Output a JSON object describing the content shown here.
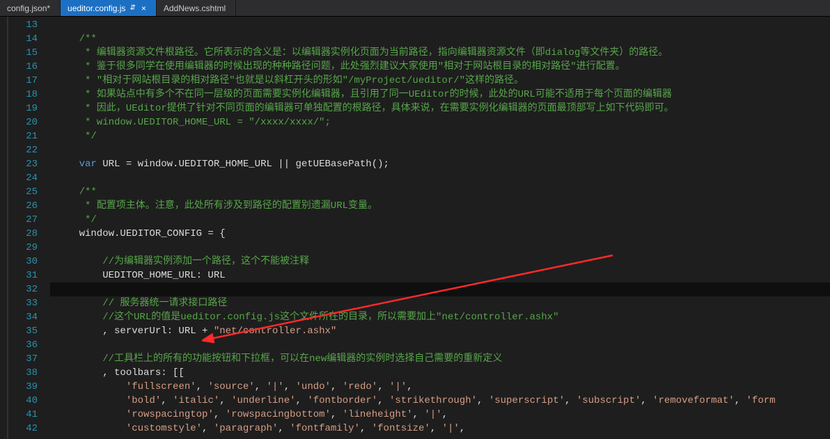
{
  "tabs": [
    {
      "label": "config.json*",
      "active": false
    },
    {
      "label": "ueditor.config.js",
      "active": true,
      "pinned": true,
      "closable": true
    },
    {
      "label": "AddNews.cshtml",
      "active": false
    }
  ],
  "startLine": 13,
  "lines": [
    {
      "n": 13,
      "segs": []
    },
    {
      "n": 14,
      "segs": [
        {
          "t": "    ",
          "c": "plain"
        },
        {
          "t": "/**",
          "c": "comment"
        }
      ]
    },
    {
      "n": 15,
      "segs": [
        {
          "t": "     * 编辑器资源文件根路径。它所表示的含义是：以编辑器实例化页面为当前路径，指向编辑器资源文件（即dialog等文件夹）的路径。",
          "c": "comment"
        }
      ]
    },
    {
      "n": 16,
      "segs": [
        {
          "t": "     * 鉴于很多同学在使用编辑器的时候出现的种种路径问题，此处强烈建议大家使用\"相对于网站根目录的相对路径\"进行配置。",
          "c": "comment"
        }
      ]
    },
    {
      "n": 17,
      "segs": [
        {
          "t": "     * \"相对于网站根目录的相对路径\"也就是以斜杠开头的形如\"/myProject/ueditor/\"这样的路径。",
          "c": "comment"
        }
      ]
    },
    {
      "n": 18,
      "segs": [
        {
          "t": "     * 如果站点中有多个不在同一层级的页面需要实例化编辑器，且引用了同一UEditor的时候，此处的URL可能不适用于每个页面的编辑器",
          "c": "comment"
        }
      ]
    },
    {
      "n": 19,
      "segs": [
        {
          "t": "     * 因此，UEditor提供了针对不同页面的编辑器可单独配置的根路径，具体来说，在需要实例化编辑器的页面最顶部写上如下代码即可。",
          "c": "comment"
        }
      ]
    },
    {
      "n": 20,
      "segs": [
        {
          "t": "     * window.UEDITOR_HOME_URL = \"/xxxx/xxxx/\";",
          "c": "comment"
        }
      ]
    },
    {
      "n": 21,
      "segs": [
        {
          "t": "     */",
          "c": "comment"
        }
      ]
    },
    {
      "n": 22,
      "segs": []
    },
    {
      "n": 23,
      "segs": [
        {
          "t": "    ",
          "c": "plain"
        },
        {
          "t": "var",
          "c": "kw"
        },
        {
          "t": " URL = window.UEDITOR_HOME_URL || getUEBasePath();",
          "c": "plain"
        }
      ]
    },
    {
      "n": 24,
      "segs": []
    },
    {
      "n": 25,
      "segs": [
        {
          "t": "    ",
          "c": "plain"
        },
        {
          "t": "/**",
          "c": "comment"
        }
      ]
    },
    {
      "n": 26,
      "segs": [
        {
          "t": "     * 配置项主体。注意，此处所有涉及到路径的配置别遗漏URL变量。",
          "c": "comment"
        }
      ]
    },
    {
      "n": 27,
      "segs": [
        {
          "t": "     */",
          "c": "comment"
        }
      ]
    },
    {
      "n": 28,
      "segs": [
        {
          "t": "    window.UEDITOR_CONFIG = {",
          "c": "plain"
        }
      ]
    },
    {
      "n": 29,
      "segs": []
    },
    {
      "n": 30,
      "segs": [
        {
          "t": "        ",
          "c": "plain"
        },
        {
          "t": "//为编辑器实例添加一个路径，这个不能被注释",
          "c": "comment"
        }
      ]
    },
    {
      "n": 31,
      "segs": [
        {
          "t": "        UEDITOR_HOME_URL: URL",
          "c": "plain"
        }
      ]
    },
    {
      "n": 32,
      "hl": true,
      "segs": []
    },
    {
      "n": 33,
      "segs": [
        {
          "t": "        ",
          "c": "plain"
        },
        {
          "t": "// 服务器统一请求接口路径",
          "c": "comment"
        }
      ]
    },
    {
      "n": 34,
      "segs": [
        {
          "t": "        ",
          "c": "plain"
        },
        {
          "t": "//这个URL的值是ueditor.config.js这个文件所在的目录，所以需要加上\"net/controller.ashx\"",
          "c": "comment"
        }
      ]
    },
    {
      "n": 35,
      "segs": [
        {
          "t": "        , serverUrl: URL + ",
          "c": "plain"
        },
        {
          "t": "\"net/controller.ashx\"",
          "c": "str"
        }
      ]
    },
    {
      "n": 36,
      "segs": []
    },
    {
      "n": 37,
      "segs": [
        {
          "t": "        ",
          "c": "plain"
        },
        {
          "t": "//工具栏上的所有的功能按钮和下拉框，可以在new编辑器的实例时选择自己需要的重新定义",
          "c": "comment"
        }
      ]
    },
    {
      "n": 38,
      "segs": [
        {
          "t": "        , toolbars: [[",
          "c": "plain"
        }
      ]
    },
    {
      "n": 39,
      "segs": [
        {
          "t": "            ",
          "c": "plain"
        },
        {
          "t": "'fullscreen'",
          "c": "str"
        },
        {
          "t": ", ",
          "c": "plain"
        },
        {
          "t": "'source'",
          "c": "str"
        },
        {
          "t": ", ",
          "c": "plain"
        },
        {
          "t": "'|'",
          "c": "str"
        },
        {
          "t": ", ",
          "c": "plain"
        },
        {
          "t": "'undo'",
          "c": "str"
        },
        {
          "t": ", ",
          "c": "plain"
        },
        {
          "t": "'redo'",
          "c": "str"
        },
        {
          "t": ", ",
          "c": "plain"
        },
        {
          "t": "'|'",
          "c": "str"
        },
        {
          "t": ",",
          "c": "plain"
        }
      ]
    },
    {
      "n": 40,
      "segs": [
        {
          "t": "            ",
          "c": "plain"
        },
        {
          "t": "'bold'",
          "c": "str"
        },
        {
          "t": ", ",
          "c": "plain"
        },
        {
          "t": "'italic'",
          "c": "str"
        },
        {
          "t": ", ",
          "c": "plain"
        },
        {
          "t": "'underline'",
          "c": "str"
        },
        {
          "t": ", ",
          "c": "plain"
        },
        {
          "t": "'fontborder'",
          "c": "str"
        },
        {
          "t": ", ",
          "c": "plain"
        },
        {
          "t": "'strikethrough'",
          "c": "str"
        },
        {
          "t": ", ",
          "c": "plain"
        },
        {
          "t": "'superscript'",
          "c": "str"
        },
        {
          "t": ", ",
          "c": "plain"
        },
        {
          "t": "'subscript'",
          "c": "str"
        },
        {
          "t": ", ",
          "c": "plain"
        },
        {
          "t": "'removeformat'",
          "c": "str"
        },
        {
          "t": ", ",
          "c": "plain"
        },
        {
          "t": "'form",
          "c": "str"
        }
      ]
    },
    {
      "n": 41,
      "segs": [
        {
          "t": "            ",
          "c": "plain"
        },
        {
          "t": "'rowspacingtop'",
          "c": "str"
        },
        {
          "t": ", ",
          "c": "plain"
        },
        {
          "t": "'rowspacingbottom'",
          "c": "str"
        },
        {
          "t": ", ",
          "c": "plain"
        },
        {
          "t": "'lineheight'",
          "c": "str"
        },
        {
          "t": ", ",
          "c": "plain"
        },
        {
          "t": "'|'",
          "c": "str"
        },
        {
          "t": ",",
          "c": "plain"
        }
      ]
    },
    {
      "n": 42,
      "segs": [
        {
          "t": "            ",
          "c": "plain"
        },
        {
          "t": "'customstyle'",
          "c": "str"
        },
        {
          "t": ", ",
          "c": "plain"
        },
        {
          "t": "'paragraph'",
          "c": "str"
        },
        {
          "t": ", ",
          "c": "plain"
        },
        {
          "t": "'fontfamily'",
          "c": "str"
        },
        {
          "t": ", ",
          "c": "plain"
        },
        {
          "t": "'fontsize'",
          "c": "str"
        },
        {
          "t": ", ",
          "c": "plain"
        },
        {
          "t": "'|'",
          "c": "str"
        },
        {
          "t": ",",
          "c": "plain"
        }
      ]
    }
  ]
}
